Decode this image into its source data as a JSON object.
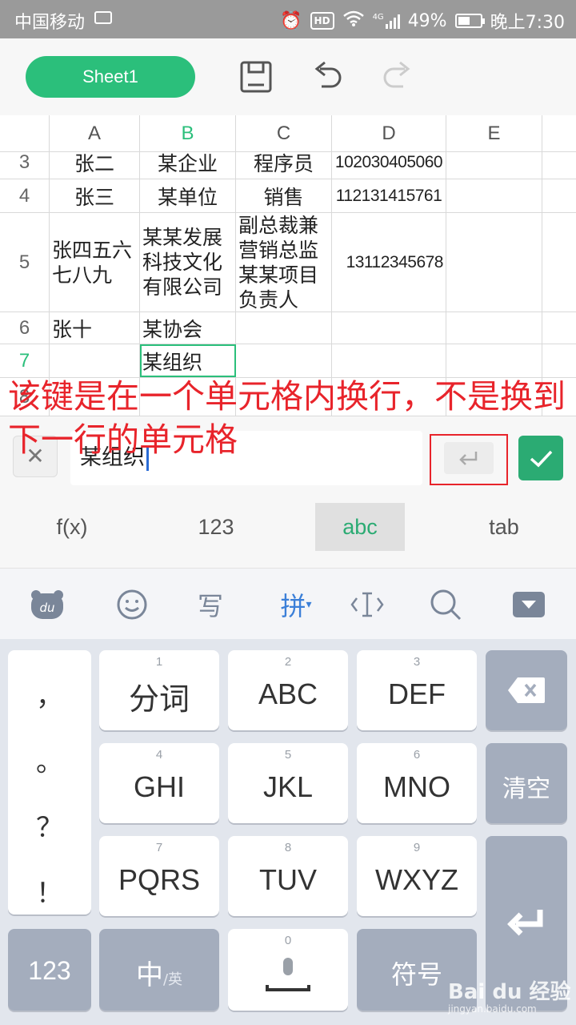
{
  "status_bar": {
    "carrier": "中国移动",
    "battery": "49%",
    "time": "晚上7:30",
    "network": "4G",
    "hd": "HD"
  },
  "toolbar": {
    "sheet_tab": "Sheet1"
  },
  "columns": [
    "A",
    "B",
    "C",
    "D",
    "E"
  ],
  "rows": [
    {
      "num": "3",
      "cells": [
        "张二",
        "某企业",
        "程序员",
        "102030405060",
        ""
      ]
    },
    {
      "num": "4",
      "cells": [
        "张三",
        "某单位",
        "销售",
        "112131415761",
        ""
      ]
    },
    {
      "num": "5",
      "cells": [
        "张四五六七八九",
        "某某发展科技文化有限公司",
        "副总裁兼营销总监·某某项目负责人",
        "13112345678",
        ""
      ],
      "wrapped": [
        "张四五六\n七八九",
        "某某发展\n科技文化\n有限公司",
        "副总裁兼\n营销总监\n某某项目\n负责人"
      ]
    },
    {
      "num": "6",
      "cells": [
        "张十",
        "某协会",
        "",
        "",
        ""
      ]
    },
    {
      "num": "7",
      "cells": [
        "",
        "某组织",
        "",
        "",
        ""
      ]
    },
    {
      "num": "8",
      "cells": [
        "",
        "",
        "",
        "",
        ""
      ]
    }
  ],
  "annotation": "该键是在一个单元格内换行，不是换到下一行的单元格",
  "input_bar": {
    "value": "某组织",
    "cancel_icon": "close-icon",
    "newline_icon": "return-icon",
    "confirm_icon": "check-icon"
  },
  "modes": [
    "f(x)",
    "123",
    "abc",
    "tab"
  ],
  "active_mode": "abc",
  "ime_toolbar": {
    "pinyin": "拼",
    "write": "写"
  },
  "keyboard": {
    "punctuation": [
      "，",
      "。",
      "？",
      "！"
    ],
    "keys": [
      {
        "num": "1",
        "label": "分词"
      },
      {
        "num": "2",
        "label": "ABC"
      },
      {
        "num": "3",
        "label": "DEF"
      },
      {
        "num": "4",
        "label": "GHI"
      },
      {
        "num": "5",
        "label": "JKL"
      },
      {
        "num": "6",
        "label": "MNO"
      },
      {
        "num": "7",
        "label": "PQRS"
      },
      {
        "num": "8",
        "label": "TUV"
      },
      {
        "num": "9",
        "label": "WXYZ"
      },
      {
        "num": "0",
        "label": ""
      }
    ],
    "clear": "清空",
    "numbers": "123",
    "lang_main": "中",
    "lang_sub": "/英",
    "symbols": "符号"
  },
  "watermark": {
    "brand": "Bai du 经验",
    "url": "jingyan.baidu.com"
  }
}
